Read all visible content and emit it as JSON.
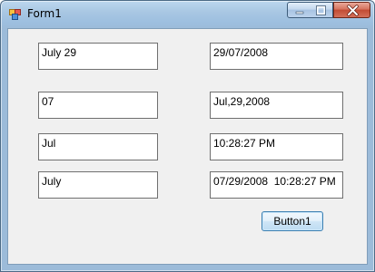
{
  "window": {
    "title": "Form1"
  },
  "textboxes": {
    "left": [
      "July 29",
      "07",
      "Jul",
      "July"
    ],
    "right": [
      "29/07/2008",
      "Jul,29,2008",
      "10:28:27 PM",
      "07/29/2008  10:28:27 PM"
    ]
  },
  "button": {
    "label": "Button1"
  },
  "icons": {
    "app": "form-app-icon",
    "minimize": "minimize-icon",
    "maximize": "maximize-icon",
    "close": "close-icon"
  },
  "colors": {
    "titlebar": "#a9c7e3",
    "client": "#f0f0f0",
    "close_button": "#c24b33",
    "button_border": "#3c7fb1"
  }
}
